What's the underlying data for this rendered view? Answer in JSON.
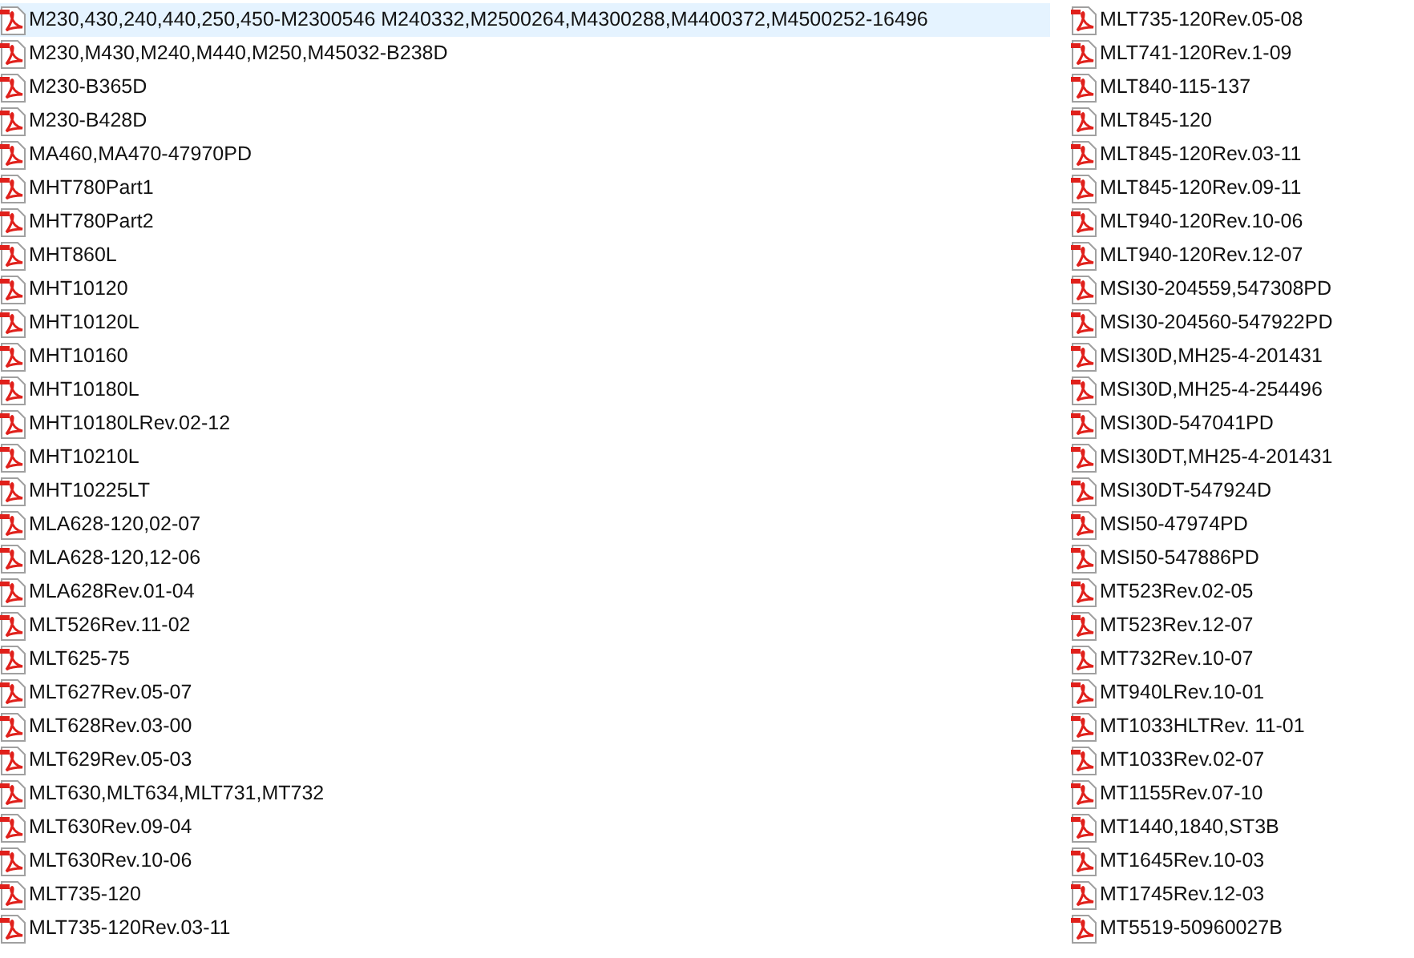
{
  "columns": [
    {
      "items": [
        {
          "name": "M230,430,240,440,250,450-M2300546 M240332,M2500264,M4300288,M4400372,M4500252-16496",
          "selected": true
        },
        {
          "name": "M230,M430,M240,M440,M250,M45032-B238D",
          "selected": false
        },
        {
          "name": "M230-B365D",
          "selected": false
        },
        {
          "name": "M230-B428D",
          "selected": false
        },
        {
          "name": "MA460,MA470-47970PD",
          "selected": false
        },
        {
          "name": "MHT780Part1",
          "selected": false
        },
        {
          "name": "MHT780Part2",
          "selected": false
        },
        {
          "name": "MHT860L",
          "selected": false
        },
        {
          "name": "MHT10120",
          "selected": false
        },
        {
          "name": "MHT10120L",
          "selected": false
        },
        {
          "name": "MHT10160",
          "selected": false
        },
        {
          "name": "MHT10180L",
          "selected": false
        },
        {
          "name": "MHT10180LRev.02-12",
          "selected": false
        },
        {
          "name": "MHT10210L",
          "selected": false
        },
        {
          "name": "MHT10225LT",
          "selected": false
        },
        {
          "name": "MLA628-120,02-07",
          "selected": false
        },
        {
          "name": "MLA628-120,12-06",
          "selected": false
        },
        {
          "name": "MLA628Rev.01-04",
          "selected": false
        },
        {
          "name": "MLT526Rev.11-02",
          "selected": false
        },
        {
          "name": "MLT625-75",
          "selected": false
        },
        {
          "name": "MLT627Rev.05-07",
          "selected": false
        },
        {
          "name": "MLT628Rev.03-00",
          "selected": false
        },
        {
          "name": "MLT629Rev.05-03",
          "selected": false
        },
        {
          "name": "MLT630,MLT634,MLT731,MT732",
          "selected": false
        },
        {
          "name": "MLT630Rev.09-04",
          "selected": false
        },
        {
          "name": "MLT630Rev.10-06",
          "selected": false
        },
        {
          "name": "MLT735-120",
          "selected": false
        },
        {
          "name": "MLT735-120Rev.03-11",
          "selected": false
        }
      ]
    },
    {
      "items": [
        {
          "name": "MLT735-120Rev.05-08",
          "selected": false
        },
        {
          "name": "MLT741-120Rev.1-09",
          "selected": false
        },
        {
          "name": "MLT840-115-137",
          "selected": false
        },
        {
          "name": "MLT845-120",
          "selected": false
        },
        {
          "name": "MLT845-120Rev.03-11",
          "selected": false
        },
        {
          "name": "MLT845-120Rev.09-11",
          "selected": false
        },
        {
          "name": "MLT940-120Rev.10-06",
          "selected": false
        },
        {
          "name": "MLT940-120Rev.12-07",
          "selected": false
        },
        {
          "name": "MSI30-204559,547308PD",
          "selected": false
        },
        {
          "name": "MSI30-204560-547922PD",
          "selected": false
        },
        {
          "name": "MSI30D,MH25-4-201431",
          "selected": false
        },
        {
          "name": "MSI30D,MH25-4-254496",
          "selected": false
        },
        {
          "name": "MSI30D-547041PD",
          "selected": false
        },
        {
          "name": "MSI30DT,MH25-4-201431",
          "selected": false
        },
        {
          "name": "MSI30DT-547924D",
          "selected": false
        },
        {
          "name": "MSI50-47974PD",
          "selected": false
        },
        {
          "name": "MSI50-547886PD",
          "selected": false
        },
        {
          "name": "MT523Rev.02-05",
          "selected": false
        },
        {
          "name": "MT523Rev.12-07",
          "selected": false
        },
        {
          "name": "MT732Rev.10-07",
          "selected": false
        },
        {
          "name": "MT940LRev.10-01",
          "selected": false
        },
        {
          "name": "MT1033HLTRev. 11-01",
          "selected": false
        },
        {
          "name": "MT1033Rev.02-07",
          "selected": false
        },
        {
          "name": "MT1155Rev.07-10",
          "selected": false
        },
        {
          "name": "MT1440,1840,ST3B",
          "selected": false
        },
        {
          "name": "MT1645Rev.10-03",
          "selected": false
        },
        {
          "name": "MT1745Rev.12-03",
          "selected": false
        },
        {
          "name": "MT5519-50960027B",
          "selected": false
        }
      ]
    }
  ]
}
